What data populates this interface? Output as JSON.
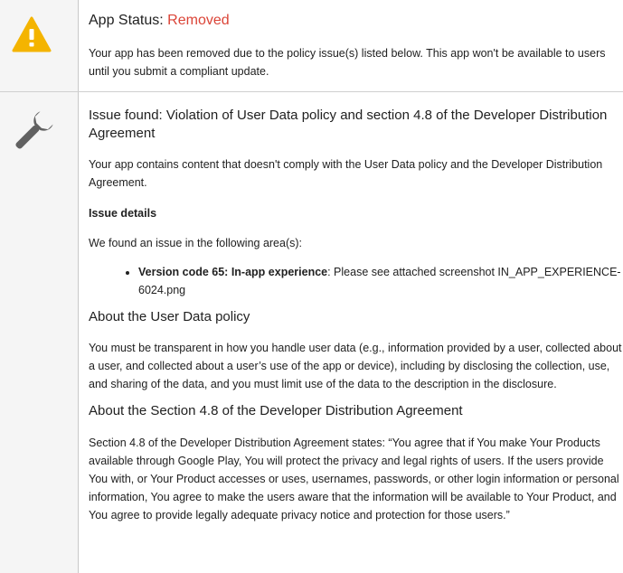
{
  "status": {
    "label": "App Status: ",
    "value": "Removed",
    "description": "Your app has been removed due to the policy issue(s) listed below. This app won't be available to users until you submit a compliant update."
  },
  "issue": {
    "title": "Issue found: Violation of User Data policy and section 4.8 of the Developer Distribution Agreement",
    "summary": "Your app contains content that doesn't comply with the User Data policy and the Developer Distribution Agreement.",
    "details_label": "Issue details",
    "area_intro": "We found an issue in the following area(s):",
    "items": [
      {
        "bold": "Version code 65: In-app experience",
        "text": ": Please see attached screenshot IN_APP_EXPERIENCE-6024.png"
      }
    ]
  },
  "policy": {
    "title": "About the User Data policy",
    "text": "You must be transparent in how you handle user data (e.g., information provided by a user, collected about a user, and collected about a user’s use of the app or device), including by disclosing the collection, use, and sharing of the data, and you must limit use of the data to the description in the disclosure."
  },
  "section": {
    "title": "About the Section 4.8 of the Developer Distribution Agreement",
    "text": "Section 4.8 of the Developer Distribution Agreement states: “You agree that if You make Your Products available through Google Play, You will protect the privacy and legal rights of users. If the users provide You with, or Your Product accesses or uses, usernames, passwords, or other login information or personal information, You agree to make the users aware that the information will be available to Your Product, and You agree to provide legally adequate privacy notice and protection for those users.”"
  },
  "icons": {
    "status": "warning-icon",
    "issue": "wrench-icon"
  },
  "colors": {
    "removed": "#db4437",
    "warning": "#f4b400",
    "wrench": "#616161"
  }
}
